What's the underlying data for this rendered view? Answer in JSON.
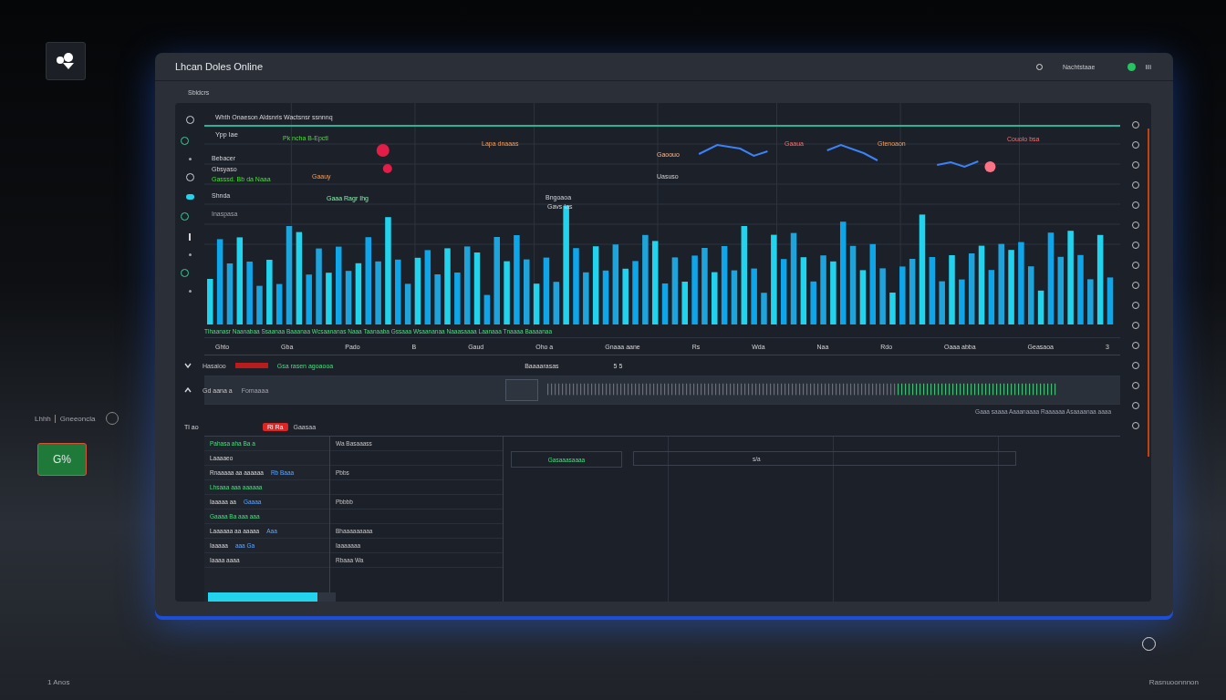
{
  "side_widget": {
    "label": "Lhhh",
    "value": "Gneeoncla"
  },
  "side_button": {
    "label": "G%"
  },
  "window": {
    "title": "Lhcan Doles Online",
    "status_text": "Nachtstaae",
    "online": true,
    "status_label": "Iili"
  },
  "section_title": "Sbldcrs",
  "chart_panel": {
    "legend": "Whth Onaeson Aldsnris Wactsnsr ssnnnq",
    "legend_sub": "Ypp lae",
    "notes": [
      {
        "text": "Bebacer",
        "kind": "plain"
      },
      {
        "text": "Gbsyaso",
        "kind": "plain"
      },
      {
        "text": "Gasssd. Bb da Naaa",
        "kind": "positive"
      },
      {
        "text": "Shnda",
        "kind": "plain"
      },
      {
        "text": "Inaspasa",
        "kind": "muted"
      }
    ],
    "annotations": [
      {
        "text": "Pk ncha B-Epctl",
        "kind": "positive"
      },
      {
        "text": "Lapa dnaaas",
        "kind": "warning"
      },
      {
        "text": "Gaaua",
        "kind": "alert"
      },
      {
        "text": "Gtenoaon",
        "kind": "warning"
      },
      {
        "text": "Couolo bsa",
        "kind": "alert"
      },
      {
        "text": "Gaoouo",
        "kind": "light"
      },
      {
        "text": "Uasuso",
        "kind": "plain"
      },
      {
        "text": "Gaauy",
        "kind": "warning"
      },
      {
        "text": "Gaaa Ragr Ihg",
        "kind": "mint"
      },
      {
        "text": "Bngoaoa",
        "kind": "plain"
      },
      {
        "text": "Gavs Ias",
        "kind": "plain"
      }
    ]
  },
  "axis_strip": "Tlhaanasr Naanabaa Ssaanaa Baaanaa Wcsaananas Naaa Taanaaba Gssaaa Wsaananaa Naaasaaaa Laanaaa Tnaaaa Baaaanaa",
  "columns": [
    "Ghto",
    "Gba",
    "Pado",
    "B",
    "Gaud",
    "Oho a",
    "Gnaaa aane",
    "Rs",
    "Wda",
    "Naa",
    "Rdo",
    "Oaaa abba",
    "Geasaoa",
    "3"
  ],
  "rows": [
    {
      "label": "Hasaioo",
      "detail": "Gsa rasen agoaooa",
      "middle": "Baaaarasas",
      "count": "5 5",
      "expanded": true
    },
    {
      "label": "Gd aana a",
      "detail": "Fomaaaa",
      "expanded": false
    }
  ],
  "timeline_caption": "Gaaa saaaa Aaaanaaaa Raaaaaa Asaaaanaa aaaa",
  "alert_row": {
    "label": "Tl ao",
    "badge": "Ri Ra",
    "text": "Gaasaa"
  },
  "list": [
    {
      "label": "Pahasa aha Ba a",
      "cell": "Wa Basaaass",
      "kind": "heading"
    },
    {
      "label": "Laaaaeo",
      "kind": "plain"
    },
    {
      "label": "Rnaaaaa aa aaaaaa",
      "tag": "Rb Baaa",
      "cell": "Pbbs",
      "kind": "plain"
    },
    {
      "label": "Lhsaaa aaa aaaaaa",
      "kind": "heading"
    },
    {
      "label": "Iaaaaa aa",
      "tag": "Gaaaa",
      "cell": "Pbbbb",
      "kind": "plain"
    },
    {
      "label": "Gaaaa Ba aaa aaa",
      "kind": "heading"
    },
    {
      "label": "Laaaaaa aa aaaaa",
      "tag": "Aaa",
      "cell": "Bhaaaaaaaaa",
      "kind": "plain"
    },
    {
      "label": "Iaaaaa",
      "tag": "aaa Ga",
      "cell": "Iaaaaaaa",
      "kind": "plain"
    },
    {
      "label": "Iaaaa aaaa",
      "cell": "Rbaaa Wa",
      "kind": "plain"
    }
  ],
  "search_box": {
    "value": "Gasaaasaaaa"
  },
  "range_box": {
    "value": "s/a"
  },
  "progress": {
    "level": 0.86
  },
  "footer_left": "1 Anos",
  "footer_right": "Rasnuoonnnon"
}
